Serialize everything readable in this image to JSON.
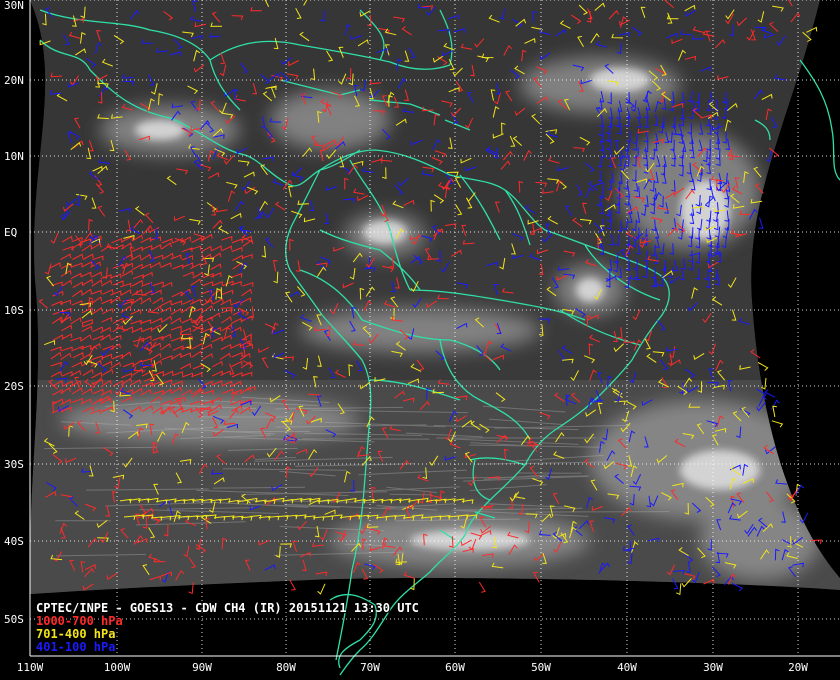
{
  "caption": {
    "title": "CPTEC/INPE - GOES13 - CDW CH4 (IR) 20151121 13:30 UTC"
  },
  "legend": [
    {
      "label": "1000-700 hPa",
      "color": "#ff2a2a"
    },
    {
      "label": "701-400 hPa",
      "color": "#f2e51a"
    },
    {
      "label": "401-100 hPa",
      "color": "#1a1aff"
    }
  ],
  "latitude_labels": [
    "30N",
    "20N",
    "10N",
    "EQ",
    "10S",
    "20S",
    "30S",
    "40S",
    "50S"
  ],
  "longitude_labels": [
    "110W",
    "100W",
    "90W",
    "80W",
    "70W",
    "60W",
    "50W",
    "40W",
    "30W",
    "20W"
  ],
  "colors": {
    "background": "#000000",
    "coastline": "#2fe0a8",
    "grid": "#ffffff"
  }
}
